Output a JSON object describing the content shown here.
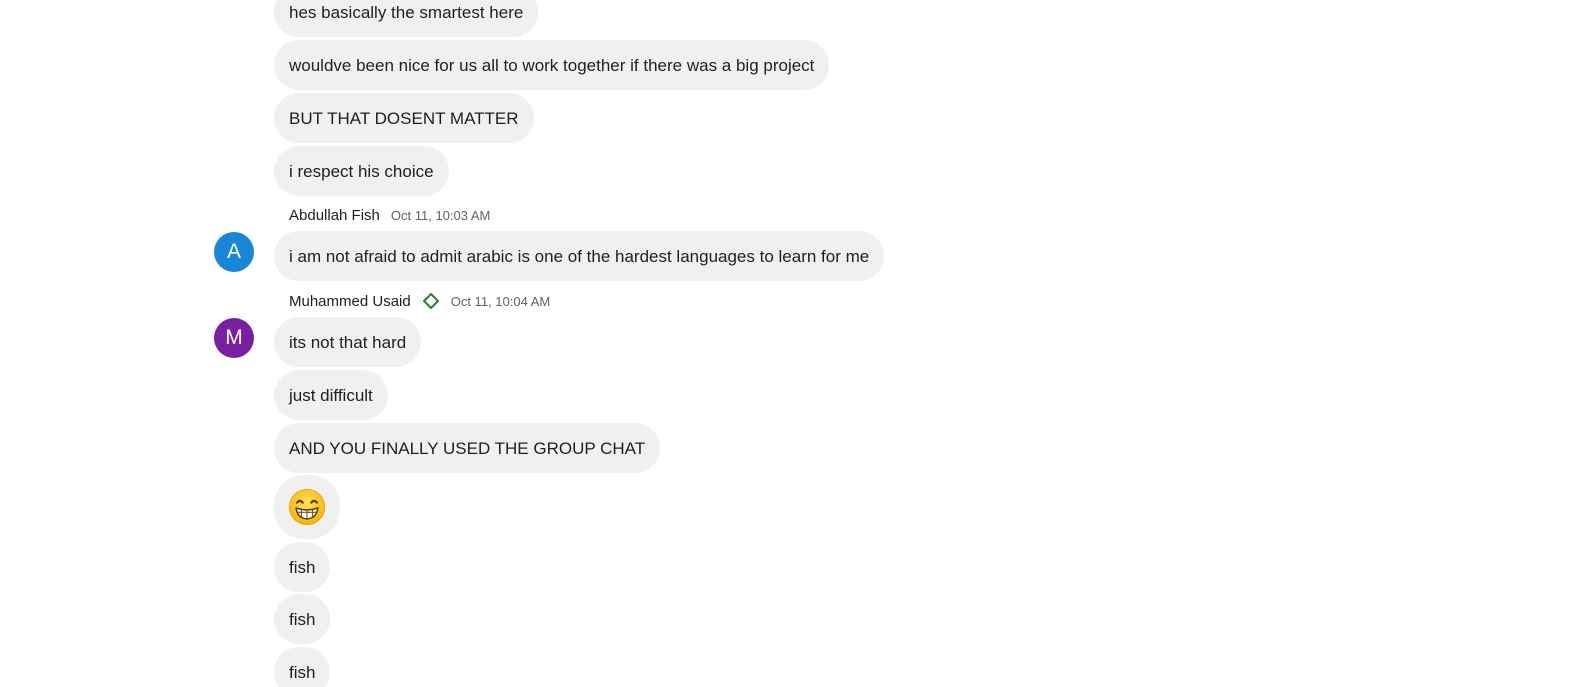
{
  "messages_top": [
    {
      "text": "hes basically the smartest here"
    },
    {
      "text": "wouldve been nice for us all to work together if there was a big project"
    },
    {
      "text": "BUT THAT DOSENT MATTER"
    },
    {
      "text": "i respect his choice"
    }
  ],
  "group_abdullah": {
    "sender": "Abdullah Fish",
    "time": "Oct 11, 10:03 AM",
    "avatar_letter": "A",
    "avatar_color": "#1a86d8",
    "messages": [
      {
        "text": "i am not afraid to admit arabic is one of the hardest languages to learn for me"
      }
    ]
  },
  "group_muhammed": {
    "sender": "Muhammed Usaid",
    "time": "Oct 11, 10:04 AM",
    "badge_icon": "diamond-outline-icon",
    "badge_color": "#2e7d32",
    "avatar_letter": "M",
    "avatar_color": "#7b1fa2",
    "messages": [
      {
        "text": "its not that hard"
      },
      {
        "text": "just difficult"
      },
      {
        "text": "AND YOU FINALLY USED THE GROUP CHAT"
      },
      {
        "emoji": "grinning-face-with-smiling-eyes-emoji"
      },
      {
        "text": "fish"
      },
      {
        "text": "fish"
      },
      {
        "text": "fish"
      }
    ]
  }
}
